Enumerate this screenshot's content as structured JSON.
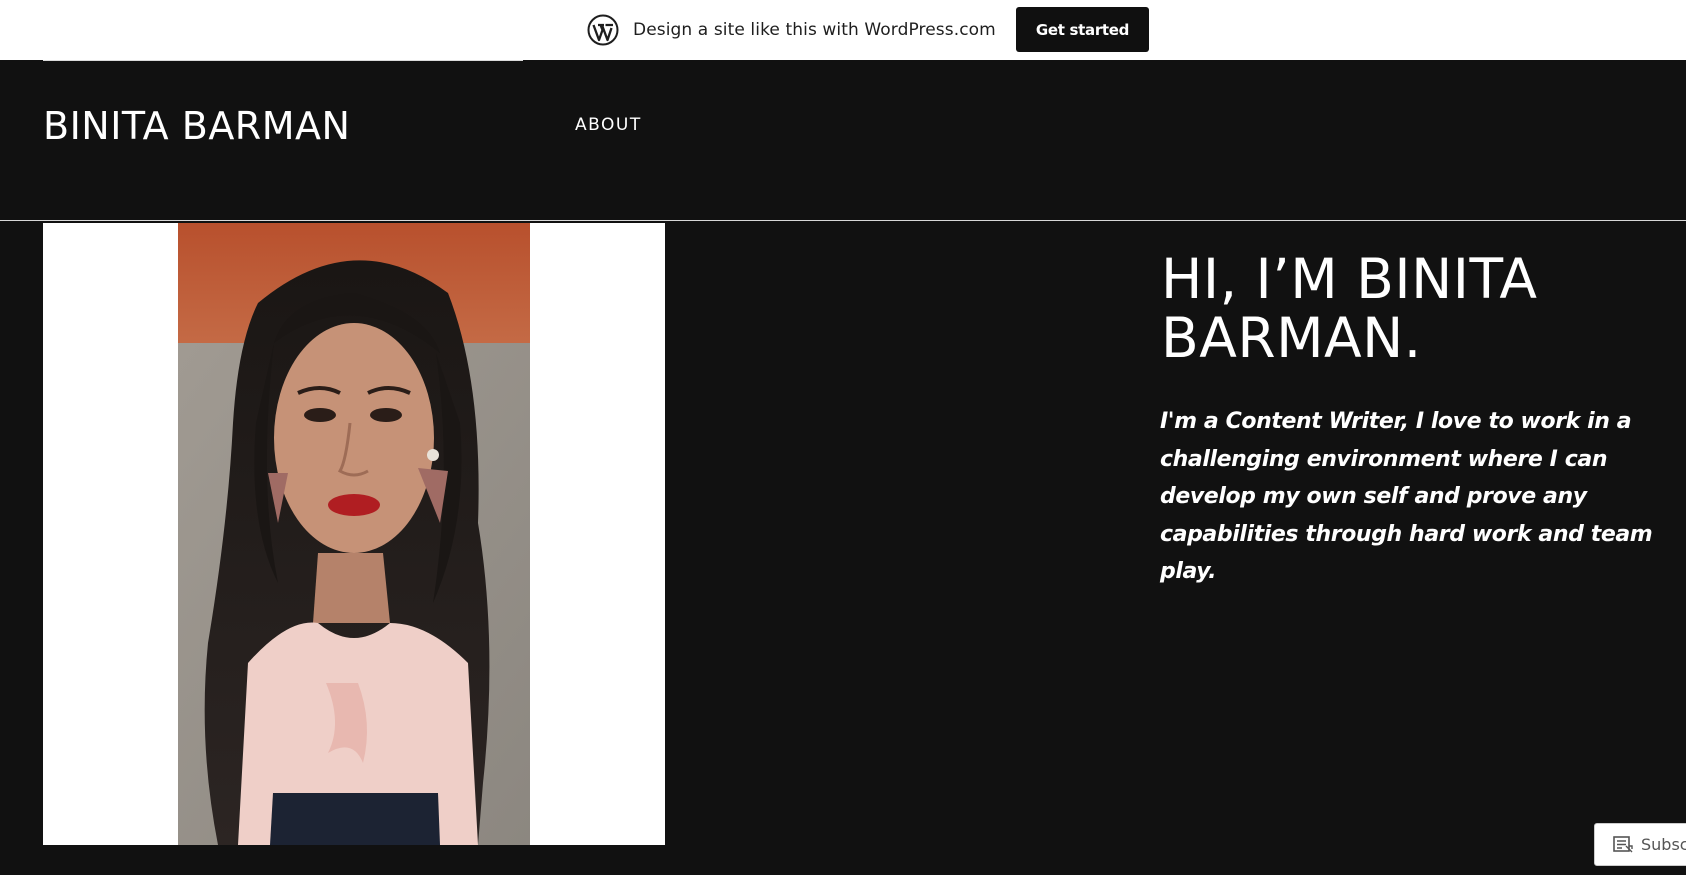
{
  "banner": {
    "icon": "wordpress-logo-icon",
    "text": "Design a site like this with WordPress.com",
    "cta_label": "Get started"
  },
  "header": {
    "site_title": "BINITA BARMAN",
    "nav": [
      {
        "label": "ABOUT"
      }
    ]
  },
  "hero": {
    "title": "HI, I’M BINITA BARMAN.",
    "description": "I'm a Content Writer, I love to work in a challenging environment where I can develop my own self and prove any capabilities through hard work and team play."
  },
  "profile_photo": {
    "alt": "Portrait photo"
  },
  "subscribe": {
    "label": "Subscribe",
    "icon": "reader-icon"
  },
  "colors": {
    "background": "#111111",
    "text": "#ffffff",
    "banner_bg": "#ffffff",
    "button_bg": "#101010"
  }
}
